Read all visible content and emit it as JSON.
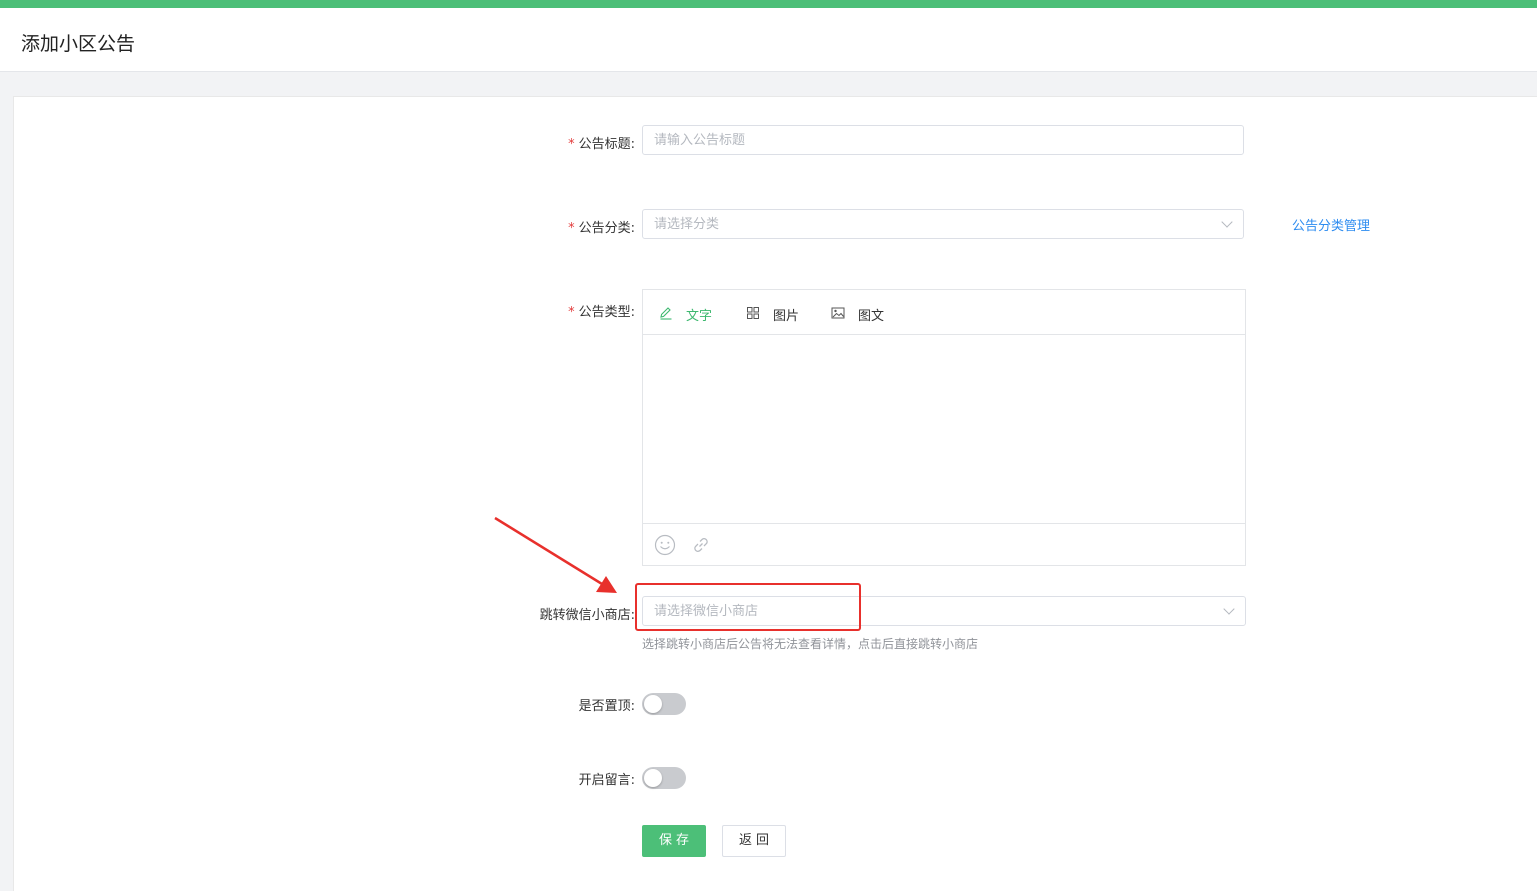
{
  "page": {
    "title": "添加小区公告"
  },
  "form": {
    "title": {
      "label": "公告标题:",
      "required": true,
      "placeholder": "请输入公告标题",
      "value": ""
    },
    "category": {
      "label": "公告分类:",
      "required": true,
      "placeholder": "请选择分类",
      "value": "",
      "manage_link": "公告分类管理"
    },
    "type": {
      "label": "公告类型:",
      "required": true,
      "tabs": [
        {
          "label": "文字",
          "icon": "pencil-icon",
          "active": true
        },
        {
          "label": "图片",
          "icon": "grid-icon",
          "active": false
        },
        {
          "label": "图文",
          "icon": "image-icon",
          "active": false
        }
      ],
      "content": "",
      "footer_icons": [
        "emoji-icon",
        "link-icon"
      ]
    },
    "shop": {
      "label": "跳转微信小商店:",
      "required": false,
      "placeholder": "请选择微信小商店",
      "value": "",
      "hint": "选择跳转小商店后公告将无法查看详情，点击后直接跳转小商店"
    },
    "pin": {
      "label": "是否置顶:",
      "on": false
    },
    "comments": {
      "label": "开启留言:",
      "on": false
    }
  },
  "buttons": {
    "save": "保存",
    "back": "返回"
  },
  "annotation": {
    "color": "#e8302c"
  },
  "colors": {
    "accent": "#4cbf78",
    "link": "#2d8cf0",
    "required": "#e23b3b"
  }
}
